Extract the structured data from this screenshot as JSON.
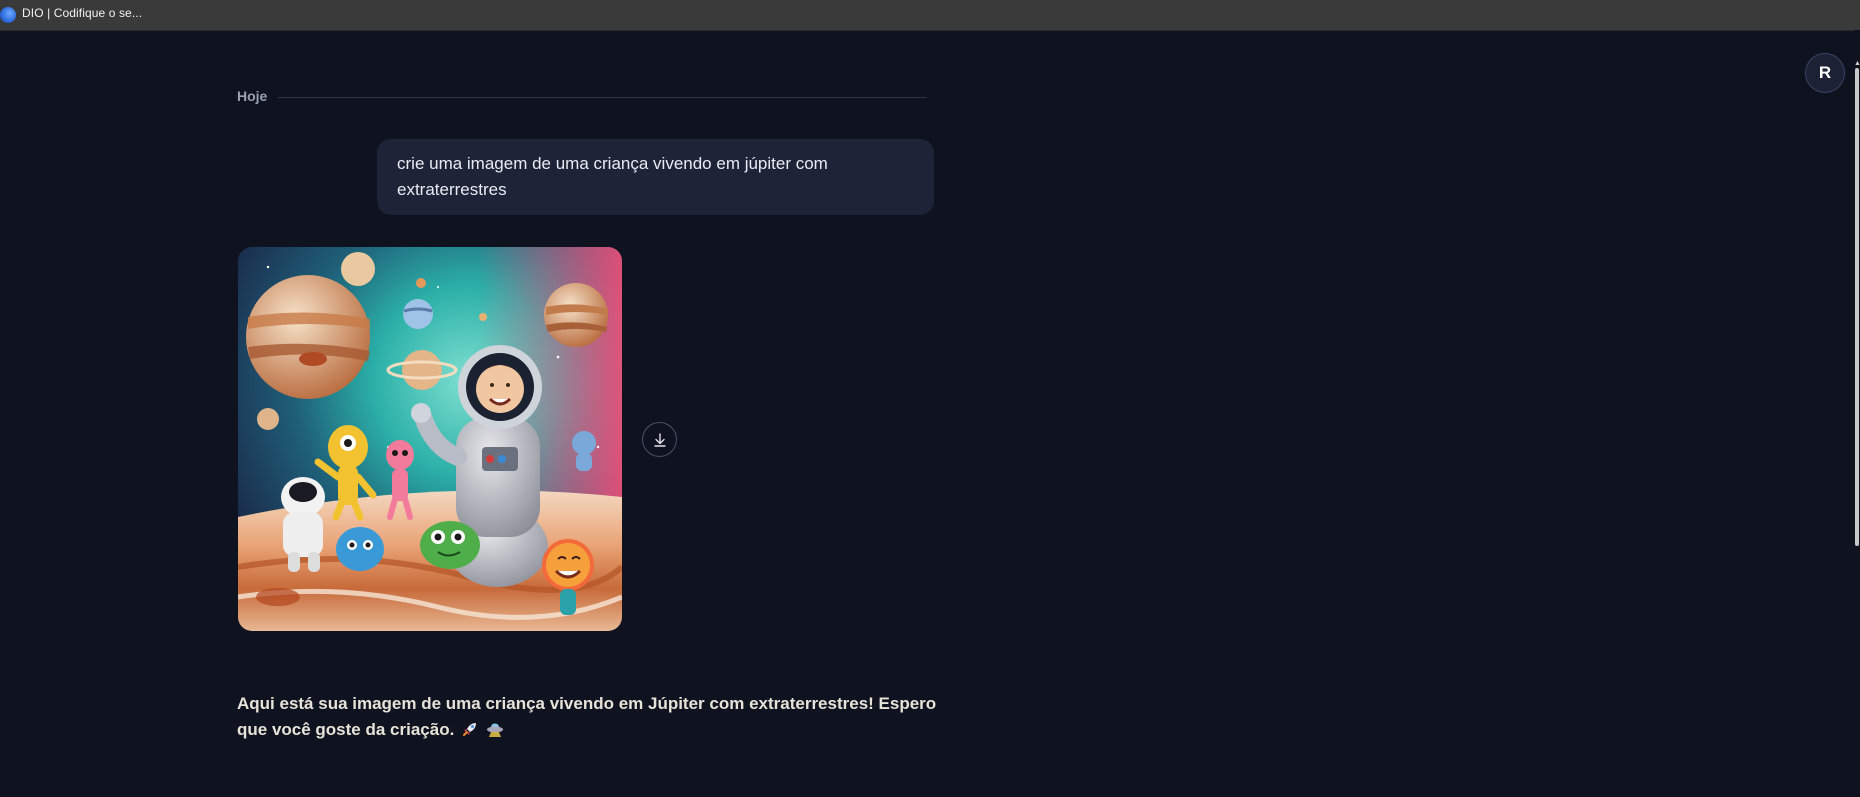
{
  "browser": {
    "tab_title": "DIO | Codifique o se..."
  },
  "user": {
    "avatar_initial": "R"
  },
  "chat": {
    "date_label": "Hoje",
    "user_message": "crie uma imagem de uma criança vivendo em júpiter com extraterrestres",
    "assistant_message": "Aqui está sua imagem de uma criança vivendo em Júpiter com extraterrestres! Espero que você goste da criação.",
    "image_alt": "Criança astronauta em Júpiter com extraterrestres coloridos",
    "download_icon": "download-icon"
  },
  "colors": {
    "background": "#0f1320",
    "bubble": "#1e2338",
    "title_bar": "#3a3a3a"
  }
}
